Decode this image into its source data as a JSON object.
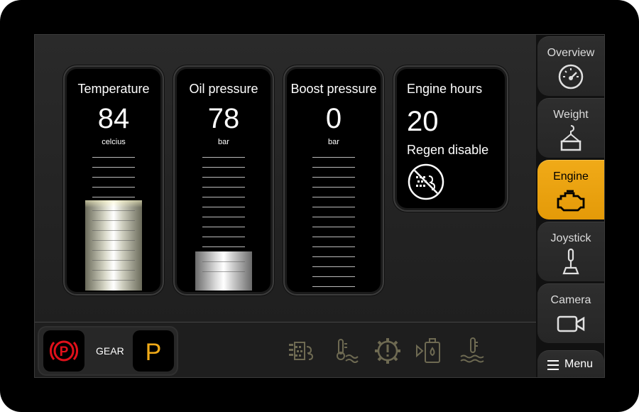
{
  "gauges": [
    {
      "title": "Temperature",
      "value": "84",
      "unit": "celcius",
      "level": 0.7
    },
    {
      "title": "Oil pressure",
      "value": "78",
      "unit": "bar",
      "level": 0.3
    },
    {
      "title": "Boost pressure",
      "value": "0",
      "unit": "bar",
      "level": 0
    }
  ],
  "engine_hours": {
    "title": "Engine hours",
    "value": "20",
    "regen_label": "Regen disable",
    "regen_icon": "regen-disabled-icon"
  },
  "nav": {
    "items": [
      {
        "label": "Overview",
        "icon": "speedometer-icon",
        "active": false
      },
      {
        "label": "Weight",
        "icon": "weight-hook-icon",
        "active": false
      },
      {
        "label": "Engine",
        "icon": "engine-icon",
        "active": true
      },
      {
        "label": "Joystick",
        "icon": "joystick-icon",
        "active": false
      },
      {
        "label": "Camera",
        "icon": "camera-icon",
        "active": false
      }
    ],
    "menu_label": "Menu"
  },
  "bottom_bar": {
    "park_brake_icon": "park-brake-icon",
    "gear_label": "GEAR",
    "gear_value": "P",
    "status_icons": [
      "exhaust-filter-icon",
      "exhaust-temperature-icon",
      "transmission-warning-icon",
      "fuel-filter-water-icon",
      "coolant-temperature-icon"
    ]
  },
  "colors": {
    "accent": "#f0aa18",
    "park_brake": "#e0101a",
    "status_icon": "#6e6a52"
  }
}
